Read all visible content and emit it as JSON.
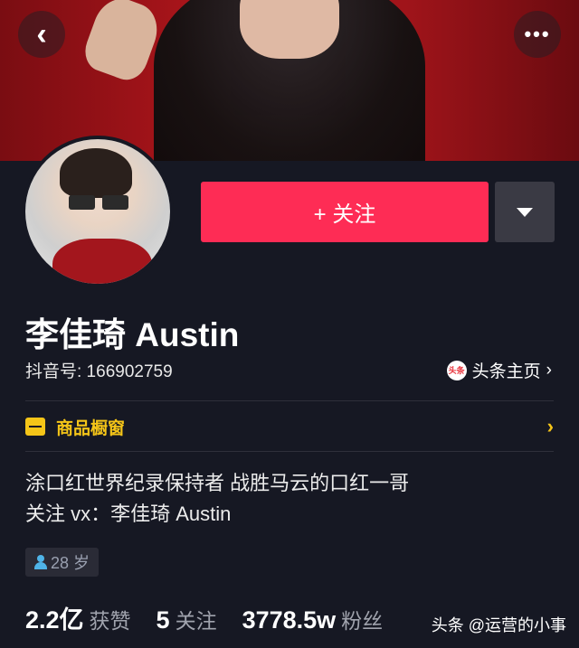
{
  "header": {
    "back_icon": "chevron-left-icon",
    "more_icon": "more-dots-icon",
    "more_label": "•••",
    "back_label": "‹"
  },
  "profile": {
    "name": "李佳琦 Austin",
    "douyin_id": "抖音号: 166902759",
    "follow_label": "+ 关注",
    "toutiao_label": "头条主页",
    "toutiao_icon_text": "头条",
    "shop_label": "商品橱窗",
    "bio_line1": "涂口红世界纪录保持者 战胜马云的口红一哥",
    "bio_line2": "关注 vx：李佳琦 Austin",
    "age": "28 岁"
  },
  "stats": [
    {
      "value": "2.2亿",
      "label": "获赞"
    },
    {
      "value": "5",
      "label": "关注"
    },
    {
      "value": "3778.5w",
      "label": "粉丝"
    }
  ],
  "watermark": "头条 @运营的小事",
  "colors": {
    "accent": "#fe2c55",
    "shop": "#f5c518",
    "background": "#161823"
  }
}
